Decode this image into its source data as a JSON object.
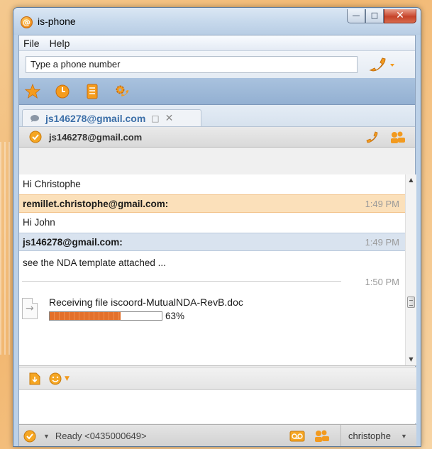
{
  "window": {
    "title": "is-phone"
  },
  "menu": {
    "items": [
      "File",
      "Help"
    ]
  },
  "dial": {
    "placeholder": "Type a phone number"
  },
  "quickbar": {
    "icons": [
      "favorites-star-icon",
      "history-clock-icon",
      "address-book-icon",
      "settings-gear-icon"
    ]
  },
  "tab": {
    "label": "js146278@gmail.com"
  },
  "contact": {
    "name": "js146278@gmail.com",
    "status": "online"
  },
  "chat": {
    "msg1": "Hi Christophe",
    "header1": {
      "sender": "remillet.christophe@gmail.com:",
      "time": "1:49 PM"
    },
    "msg2": "Hi John",
    "header2": {
      "sender": "js146278@gmail.com:",
      "time": "1:49 PM"
    },
    "msg3": "see the NDA template attached ...",
    "sep_time": "1:50 PM",
    "file": {
      "label": "Receiving file iscoord-MutualNDA-RevB.doc",
      "progress": 0.63,
      "progress_text": "63%"
    }
  },
  "status": {
    "text": "Ready <0435000649>",
    "user": "christophe"
  },
  "colors": {
    "accent": "#f08d1a",
    "header_orange": "#fbe0ba",
    "header_blue": "#d9e3ef",
    "tab_text": "#3c6fa8"
  }
}
